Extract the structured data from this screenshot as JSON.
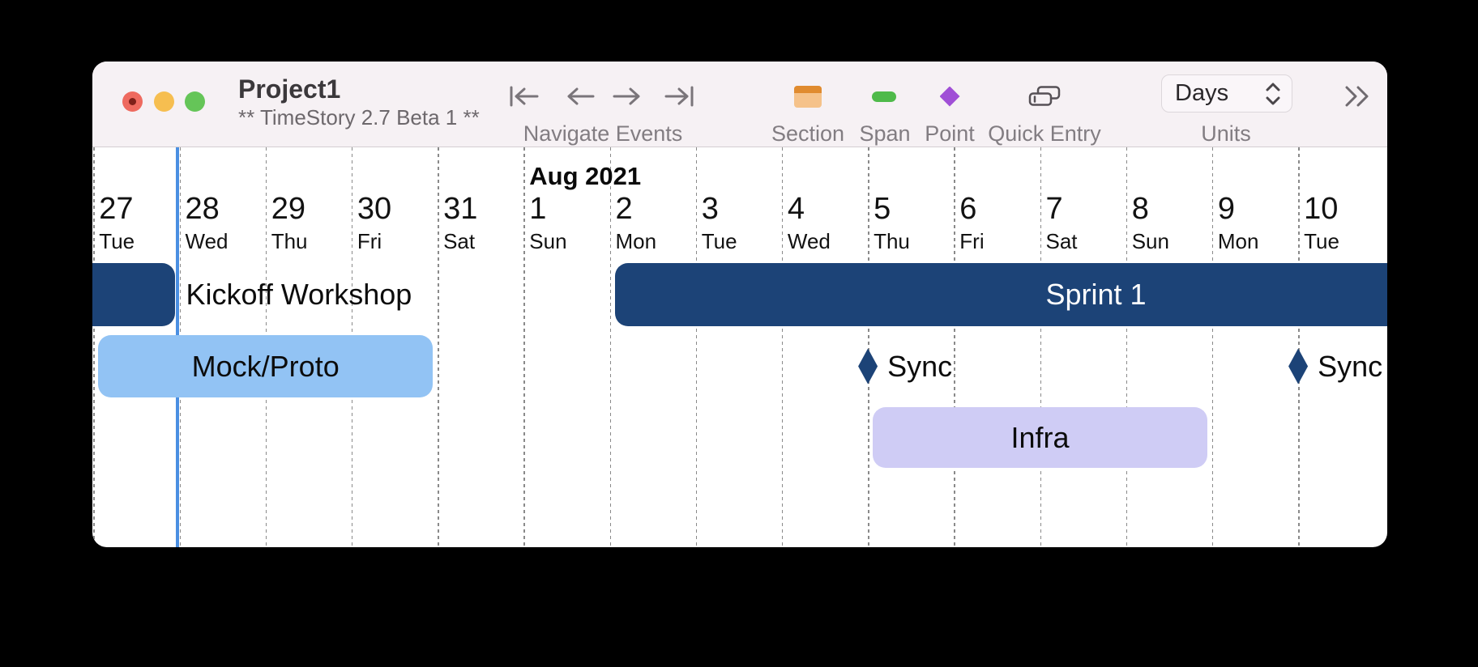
{
  "window": {
    "title": "Project1",
    "subtitle": "** TimeStory 2.7 Beta 1 **"
  },
  "toolbar": {
    "navigate_label": "Navigate Events",
    "section_label": "Section",
    "span_label": "Span",
    "point_label": "Point",
    "quick_entry_label": "Quick Entry",
    "units_label": "Units",
    "units_value": "Days",
    "icons": [
      "skip-to-first-icon",
      "previous-event-icon",
      "next-event-icon",
      "skip-to-last-icon",
      "section-icon",
      "span-icon",
      "point-icon",
      "quick-entry-icon",
      "stepper-icon",
      "overflow-chevrons-icon"
    ]
  },
  "colors": {
    "navy": "#1c4377",
    "sky": "#92c3f4",
    "lavender": "#cfccf5",
    "today_line": "#4a8fe2",
    "toolbar_bg": "#f6f1f4",
    "traffic_red": "#ee6a5f",
    "traffic_yellow": "#f6be50",
    "traffic_green": "#65c558"
  },
  "timeline": {
    "month_label": "Aug 2021",
    "month_label_day_index": 5,
    "today_day_index": 1,
    "days": [
      {
        "num": "27",
        "weekday": "Tue"
      },
      {
        "num": "28",
        "weekday": "Wed"
      },
      {
        "num": "29",
        "weekday": "Thu"
      },
      {
        "num": "30",
        "weekday": "Fri"
      },
      {
        "num": "31",
        "weekday": "Sat"
      },
      {
        "num": "1",
        "weekday": "Sun"
      },
      {
        "num": "2",
        "weekday": "Mon"
      },
      {
        "num": "3",
        "weekday": "Tue"
      },
      {
        "num": "4",
        "weekday": "Wed"
      },
      {
        "num": "5",
        "weekday": "Thu"
      },
      {
        "num": "6",
        "weekday": "Fri"
      },
      {
        "num": "7",
        "weekday": "Sat"
      },
      {
        "num": "8",
        "weekday": "Sun"
      },
      {
        "num": "9",
        "weekday": "Mon"
      },
      {
        "num": "10",
        "weekday": "Tue"
      }
    ],
    "events": [
      {
        "label": "Kickoff Workshop",
        "type": "span",
        "start": -2,
        "end": 1,
        "row": 0,
        "color": "navy",
        "label_style": "after"
      },
      {
        "label": "Sprint 1",
        "type": "span",
        "start": 6,
        "end": 17.3,
        "row": 0,
        "color": "navy",
        "label_style": "inside_white"
      },
      {
        "label": "Mock/Proto",
        "type": "span",
        "start": 0,
        "end": 4,
        "row": 1,
        "color": "sky",
        "label_style": "inside"
      },
      {
        "label": "Sync",
        "type": "point",
        "at": 9,
        "row": 1,
        "color": "navy",
        "label_style": "after"
      },
      {
        "label": "Infra",
        "type": "span",
        "start": 9,
        "end": 13,
        "row": 2,
        "color": "lavender",
        "label_style": "inside"
      },
      {
        "label": "Sync",
        "type": "point",
        "at": 14,
        "row": 1,
        "color": "navy",
        "label_style": "after"
      }
    ]
  }
}
